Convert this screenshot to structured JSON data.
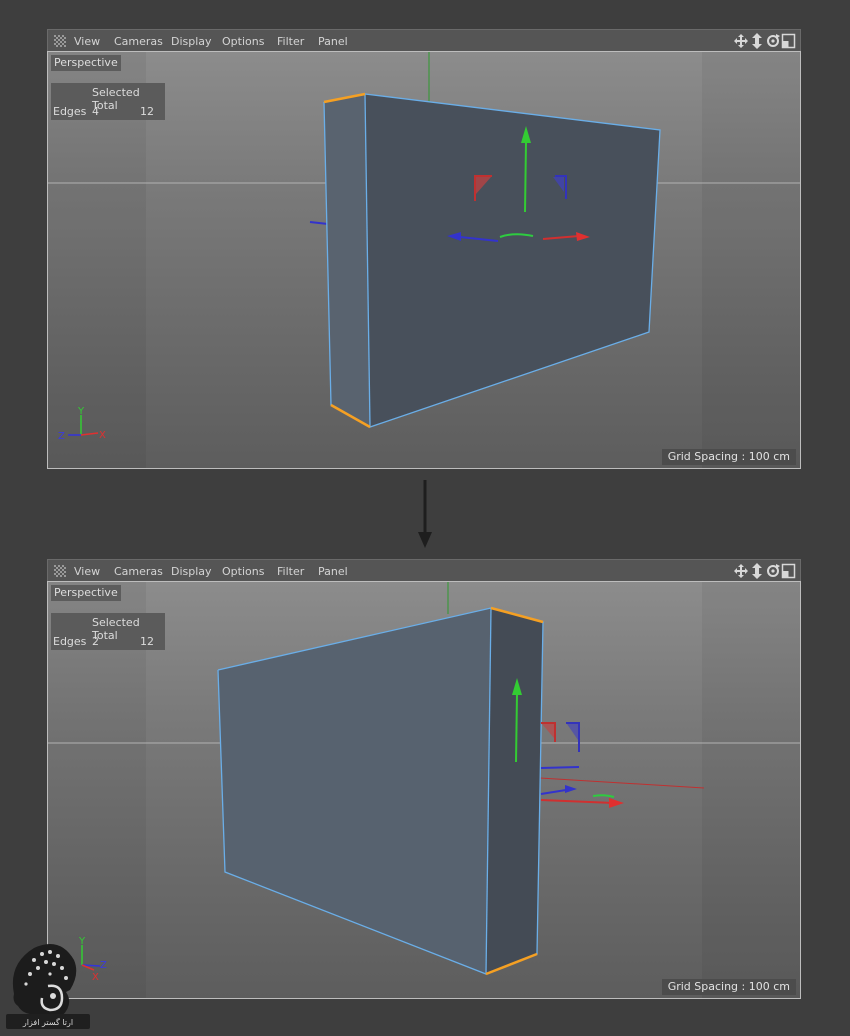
{
  "menu": {
    "items": [
      "View",
      "Cameras",
      "Display",
      "Options",
      "Filter",
      "Panel"
    ],
    "nav_icons": [
      "move-view-icon",
      "dolly-view-icon",
      "rotate-view-icon",
      "maximize-view-icon"
    ]
  },
  "viewports": [
    {
      "camera": "Perspective",
      "hud": {
        "header": "Selected Total",
        "label": "Edges",
        "selected": "4",
        "total": "12"
      },
      "grid_spacing": "Grid Spacing : 100 cm",
      "axis_labels": {
        "y": "Y",
        "z": "Z",
        "x": "X"
      }
    },
    {
      "camera": "Perspective",
      "hud": {
        "header": "Selected Total",
        "label": "Edges",
        "selected": "2",
        "total": "12"
      },
      "grid_spacing": "Grid Spacing : 100 cm",
      "axis_labels": {
        "y": "Y",
        "z": "Z",
        "x": "X"
      }
    }
  ],
  "colors": {
    "selected_edge": "#f5a023",
    "polygon_edge": "#6aaee8",
    "axis_x": "#e03030",
    "axis_y": "#2ecc40",
    "axis_z": "#3a3ae0"
  },
  "watermark_text": "ارتا گستر افزار"
}
